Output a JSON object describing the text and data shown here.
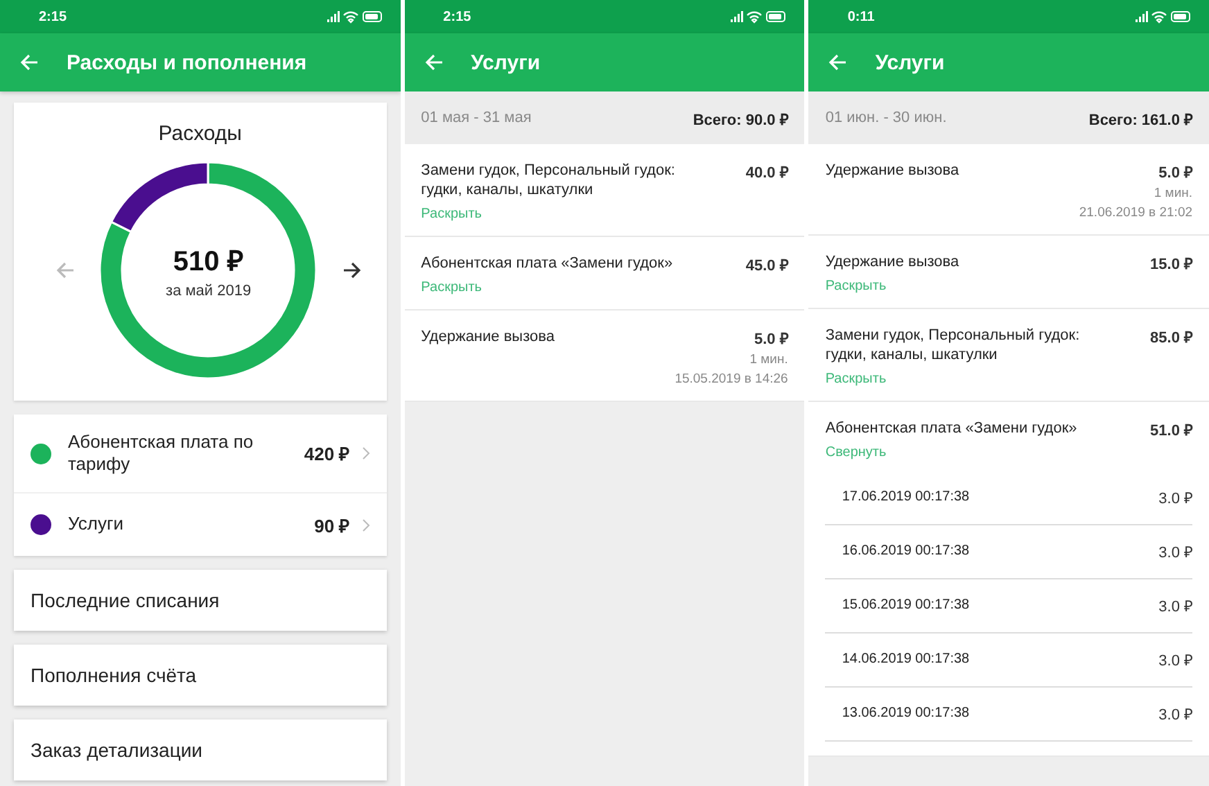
{
  "screens": [
    {
      "kind": "overview",
      "status": {
        "time": "2:15"
      },
      "app_bar": {
        "title": "Расходы и пополнения"
      },
      "summary": {
        "title": "Расходы",
        "total": "510 ₽",
        "period": "за май 2019",
        "chart_data": {
          "type": "donut",
          "categories": [
            "Абонентская плата по тарифу",
            "Услуги"
          ],
          "values": [
            82.4,
            17.6
          ]
        }
      },
      "breakdown": [
        {
          "amount": "420 ₽",
          "color": "#1cb35b"
        },
        {
          "amount": "90 ₽",
          "color": "#4a0e8f"
        }
      ],
      "menu": [
        "Последние списания",
        "Пополнения счёта",
        "Заказ детализации"
      ]
    },
    {
      "kind": "services",
      "status": {
        "time": "2:15"
      },
      "app_bar": {
        "title": "Услуги"
      },
      "period": "01 мая - 31 мая",
      "total": "Всего: 90.0 ₽",
      "items": [
        {
          "name": "Замени гудок, Персональный гудок: гудки, каналы, шкатулки",
          "amount": "40.0 ₽",
          "toggle": "Раскрыть"
        },
        {
          "name": "Абонентская плата «Замени гудок»",
          "amount": "45.0 ₽",
          "toggle": "Раскрыть"
        },
        {
          "name": "Удержание вызова",
          "amount": "5.0 ₽",
          "duration": "1 мин.",
          "date": "15.05.2019 в 14:26"
        }
      ]
    },
    {
      "kind": "services",
      "status": {
        "time": "0:11"
      },
      "app_bar": {
        "title": "Услуги"
      },
      "period": "01 июн. - 30 июн.",
      "total": "Всего: 161.0 ₽",
      "items": [
        {
          "name": "Удержание вызова",
          "amount": "5.0 ₽",
          "duration": "1 мин.",
          "date": "21.06.2019 в 21:02"
        },
        {
          "name": "Удержание вызова",
          "amount": "15.0 ₽",
          "toggle": "Раскрыть"
        },
        {
          "name": "Замени гудок, Персональный гудок: гудки, каналы, шкатулки",
          "amount": "85.0 ₽",
          "toggle": "Раскрыть"
        },
        {
          "name": "Абонентская плата «Замени гудок»",
          "amount": "51.0 ₽",
          "toggle": "Свернуть",
          "children": [
            {
              "date": "17.06.2019 00:17:38",
              "amount": "3.0 ₽"
            },
            {
              "date": "16.06.2019 00:17:38",
              "amount": "3.0 ₽"
            },
            {
              "date": "15.06.2019 00:17:38",
              "amount": "3.0 ₽"
            },
            {
              "date": "14.06.2019 00:17:38",
              "amount": "3.0 ₽"
            },
            {
              "date": "13.06.2019 00:17:38",
              "amount": "3.0 ₽"
            }
          ]
        }
      ]
    }
  ]
}
